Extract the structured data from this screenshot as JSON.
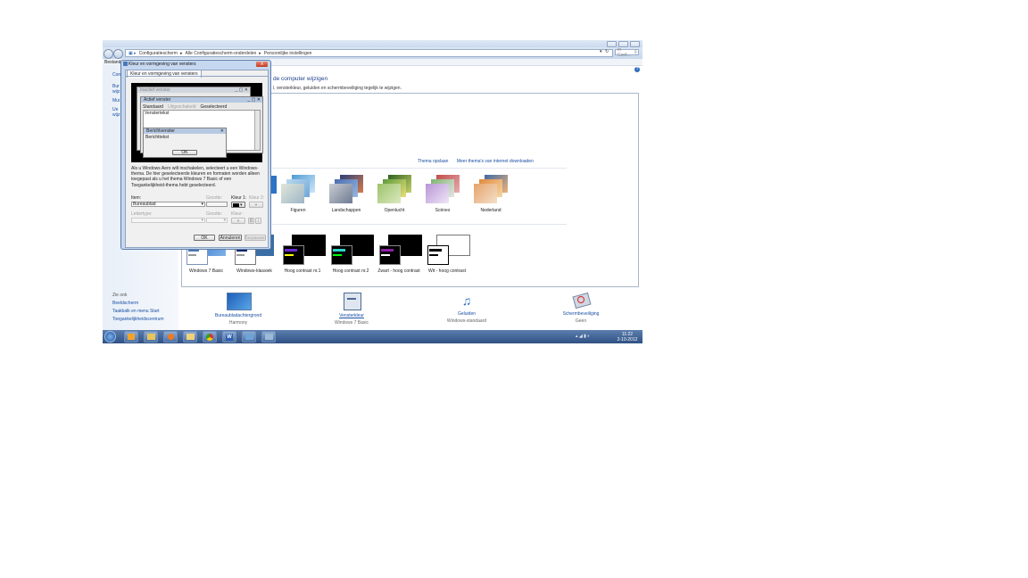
{
  "window": {
    "breadcrumb": [
      "Configuratiescherm",
      "Alle Configuratiescherm-onderdelen",
      "Persoonlijke instellingen"
    ],
    "search_placeholder": "In Conf...",
    "menu_label": "Bestand"
  },
  "left_pane": {
    "items_partial": [
      "Con",
      "Bur",
      "wijz",
      "Mui",
      "Ue",
      "wijz"
    ],
    "see_also_title": "Zie ook",
    "see_also": [
      "Beeldscherm",
      "Taakbalk en menu Start",
      "Toegankelijkheidscentrum"
    ]
  },
  "main": {
    "heading": "de computer wijzigen",
    "subline": "l, vensterkleur, geluiden en schermbeveiliging tegelijk te wijzigen.",
    "link_save": "Thema opslaan",
    "link_more": "Meer thema's van internet downloaden",
    "aero_themes": [
      {
        "label": "Figuren"
      },
      {
        "label": "Landschappen"
      },
      {
        "label": "Openlucht"
      },
      {
        "label": "Scènes"
      },
      {
        "label": "Nederland"
      }
    ],
    "basic_themes": [
      {
        "label": "Windows 7 Basic"
      },
      {
        "label": "Windows-klassiek"
      },
      {
        "label": "Hoog contrast nr.1"
      },
      {
        "label": "Hoog contrast nr.2"
      },
      {
        "label": "Zwart - hoog contrast"
      },
      {
        "label": "Wit - hoog contrast"
      }
    ]
  },
  "bottom": [
    {
      "label": "Bureaubladachtergrond",
      "value": "Harmony",
      "icon": "wallpaper-icon"
    },
    {
      "label": "Vensterkleur",
      "value": "Windows 7 Basic",
      "icon": "window-color-icon"
    },
    {
      "label": "Geluiden",
      "value": "Windows-standaard",
      "icon": "sounds-icon"
    },
    {
      "label": "Schermbeveiliging",
      "value": "Geen",
      "icon": "screensaver-icon"
    }
  ],
  "dialog": {
    "title": "Kleur en vormgeving van vensters",
    "close_glyph": "X",
    "tab": "Kleur en vormgeving van vensters",
    "inactive_window": "Inactief venster",
    "active_window": "Actief venster",
    "menu_items": [
      "Standaard",
      "Uitgeschakeld",
      "Geselecteerd"
    ],
    "window_text": "Venstertekst",
    "message_box_title": "Berichtvenster",
    "message_text": "Berichttekst",
    "ok_small": "OK",
    "description": "Als u Windows Aero wilt inschakelen, selecteert u een Windows-thema. De hier geselecteerde kleuren en formaten worden alleen toegepast als u het thema Windows 7 Basic of een Toegankelijkheid-thema hebt geselecteerd.",
    "item_label": "Item:",
    "item_value": "Bureaublad",
    "size_label": "Grootte:",
    "color1_label": "Kleur 1:",
    "color2_label": "Kleur 2:",
    "font_label": "Lettertype:",
    "font_size_label": "Grootte:",
    "font_color_label": "Kleur:",
    "bold_glyph": "B",
    "italic_glyph": "I",
    "ok": "OK",
    "cancel": "Annuleren",
    "apply": "Toepassen"
  },
  "taskbar": {
    "time": "11:22",
    "date": "2-10-2012",
    "apps": [
      "windows-orb-icon",
      "outlook-icon",
      "explorer-icon",
      "media-player-icon",
      "folder-icon",
      "chrome-icon",
      "word-icon",
      "remote-desktop-icon",
      "control-panel-icon"
    ]
  },
  "colors": {
    "accent": "#1a4fa3",
    "taskbar": "#2f5083",
    "dialog_frame": "#c6d8ef"
  }
}
